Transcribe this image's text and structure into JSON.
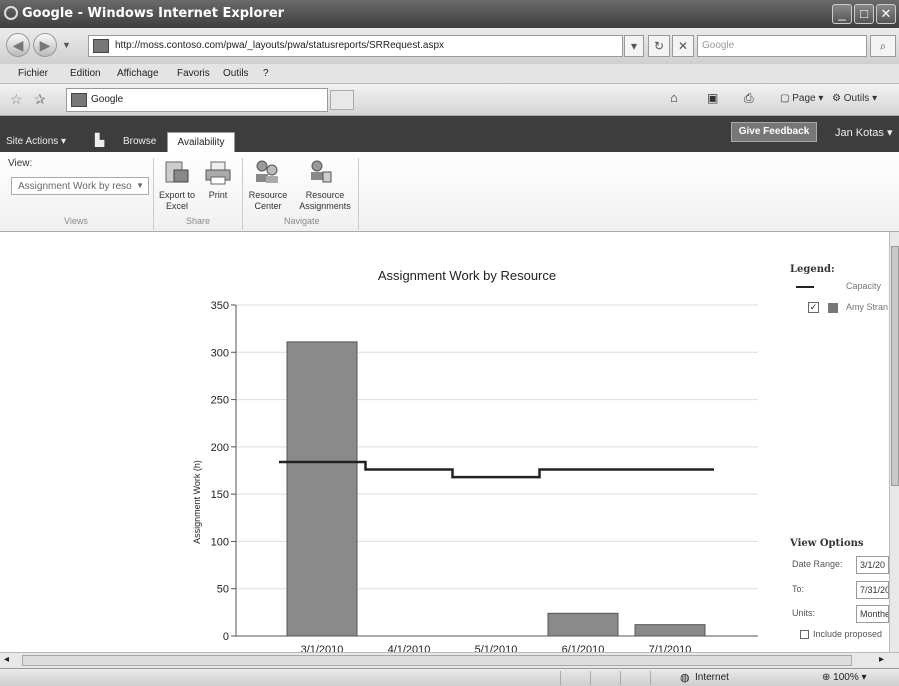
{
  "window": {
    "title": "Google - Windows Internet Explorer"
  },
  "address": {
    "url": "http://moss.contoso.com/pwa/_layouts/pwa/statusreports/SRRequest.aspx",
    "search_placeholder": "Google"
  },
  "menu": [
    "Fichier",
    "Edition",
    "Affichage",
    "Favoris",
    "Outils",
    "?"
  ],
  "tab": {
    "label": "Google"
  },
  "toolbar": {
    "page": "Page",
    "tools": "Outils"
  },
  "sharepoint": {
    "site_actions": "Site Actions",
    "browse": "Browse",
    "availability": "Availability",
    "feedback": "Give Feedback",
    "user": "Jan Kotas"
  },
  "ribbon": {
    "view_label": "View:",
    "view_value": "Assignment Work by reso",
    "groups": {
      "views": "Views",
      "share": "Share",
      "navigate": "Navigate"
    },
    "buttons": {
      "export_l1": "Export to",
      "export_l2": "Excel",
      "print": "Print",
      "center_l1": "Resource",
      "center_l2": "Center",
      "assign_l1": "Resource",
      "assign_l2": "Assignments"
    }
  },
  "legend": {
    "title": "Legend:",
    "capacity": "Capacity",
    "resource": "Amy Stran"
  },
  "view_options": {
    "title": "View Options",
    "date_range_label": "Date Range:",
    "date_range_value": "3/1/20",
    "to_label": "To:",
    "to_value": "7/31/20",
    "units_label": "Units:",
    "units_value": "Monthe",
    "include_label": "Include proposed"
  },
  "status": {
    "zone": "Internet",
    "zoom": "100%"
  },
  "colors": {
    "bar": "#8a8a8a",
    "line": "#222222"
  },
  "chart_data": {
    "type": "bar",
    "title": "Assignment Work by Resource",
    "xlabel": "",
    "ylabel": "Assignment Work (h)",
    "categories": [
      "3/1/2010",
      "4/1/2010",
      "5/1/2010",
      "6/1/2010",
      "7/1/2010"
    ],
    "series": [
      {
        "name": "Amy Stran",
        "type": "bar",
        "values": [
          311,
          0,
          0,
          24,
          12
        ]
      },
      {
        "name": "Capacity",
        "type": "step-line",
        "values": [
          184,
          176,
          168,
          176,
          176
        ]
      }
    ],
    "ylim": [
      0,
      350
    ],
    "yticks": [
      0,
      50,
      100,
      150,
      200,
      250,
      300,
      350
    ],
    "grid": true
  }
}
